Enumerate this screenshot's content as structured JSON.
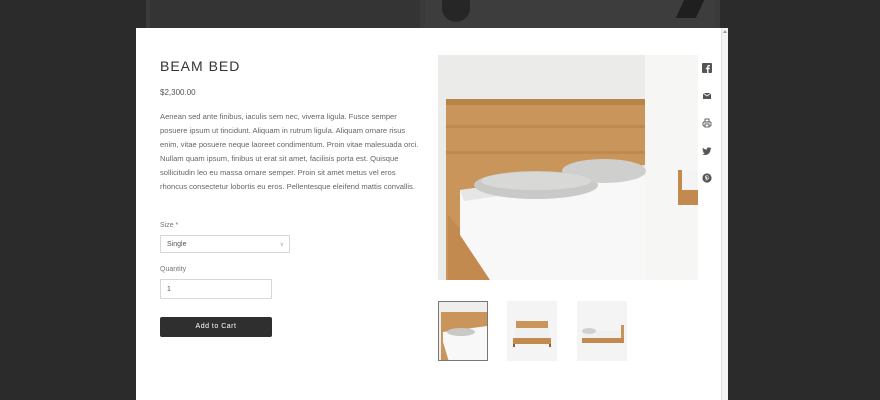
{
  "product": {
    "title": "BEAM BED",
    "price": "$2,300.00",
    "description": "Aenean sed ante finibus, iaculis sem nec, viverra ligula. Fusce semper posuere ipsum ut tincidunt. Aliquam in rutrum ligula. Aliquam ornare risus enim, vitae posuere neque laoreet condimentum. Proin vitae malesuada orci. Nullam quam ipsum, finibus ut erat sit amet, facilisis porta est. Quisque sollicitudin leo eu massa ornare semper. Proin sit amet metus vel eros rhoncus consectetur lobortis eu eros. Pellentesque eleifend mattis convallis."
  },
  "form": {
    "size_label": "Size *",
    "size_value": "Single",
    "quantity_label": "Quantity",
    "quantity_value": "1",
    "add_to_cart": "Add to Cart"
  },
  "gallery": {
    "thumbnails": [
      "bed-corner-closeup",
      "bed-front-view",
      "bed-side-view"
    ],
    "selected_index": 0
  },
  "share_icons": [
    "facebook-icon",
    "email-icon",
    "print-icon",
    "twitter-icon",
    "pinterest-icon"
  ]
}
